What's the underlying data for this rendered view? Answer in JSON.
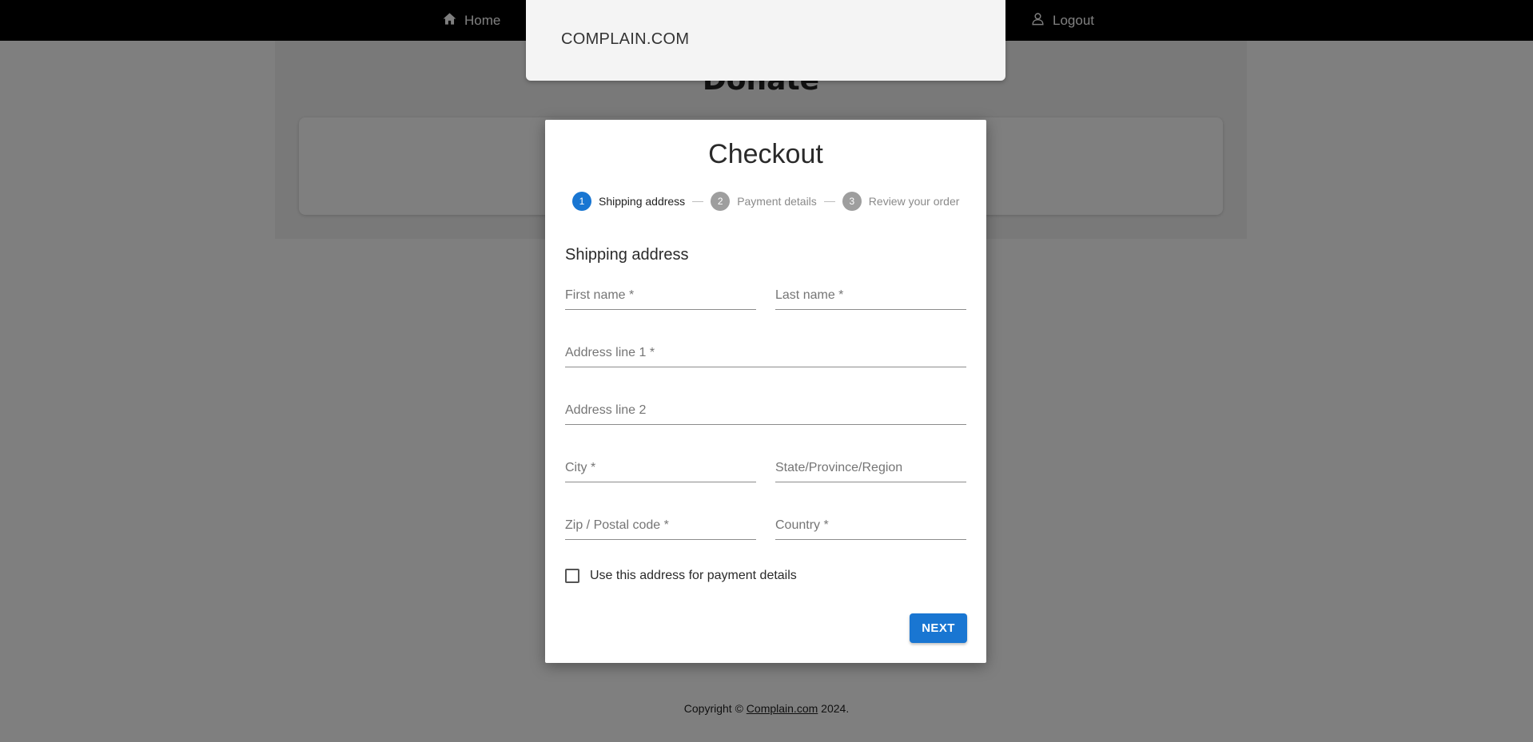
{
  "nav": {
    "home_label": "Home",
    "logout_label": "Logout"
  },
  "page": {
    "title": "Donate"
  },
  "footer": {
    "prefix": "Copyright © ",
    "link_text": "Complain.com",
    "suffix": " 2024."
  },
  "brand": {
    "name": "COMPLAIN.COM"
  },
  "checkout": {
    "title": "Checkout",
    "steps": [
      {
        "number": "1",
        "label": "Shipping address",
        "active": true
      },
      {
        "number": "2",
        "label": "Payment details",
        "active": false
      },
      {
        "number": "3",
        "label": "Review your order",
        "active": false
      }
    ],
    "section_title": "Shipping address",
    "fields": {
      "first_name": "First name *",
      "last_name": "Last name *",
      "address1": "Address line 1 *",
      "address2": "Address line 2",
      "city": "City *",
      "state": "State/Province/Region",
      "zip": "Zip / Postal code *",
      "country": "Country *"
    },
    "checkbox_label": "Use this address for payment details",
    "checkbox_checked": false,
    "next_label": "NEXT"
  },
  "colors": {
    "primary": "#1976d2",
    "navbar": "#000000",
    "step_inactive": "#9e9e9e"
  },
  "icons": {
    "home": "home-icon",
    "logout": "user-icon"
  }
}
